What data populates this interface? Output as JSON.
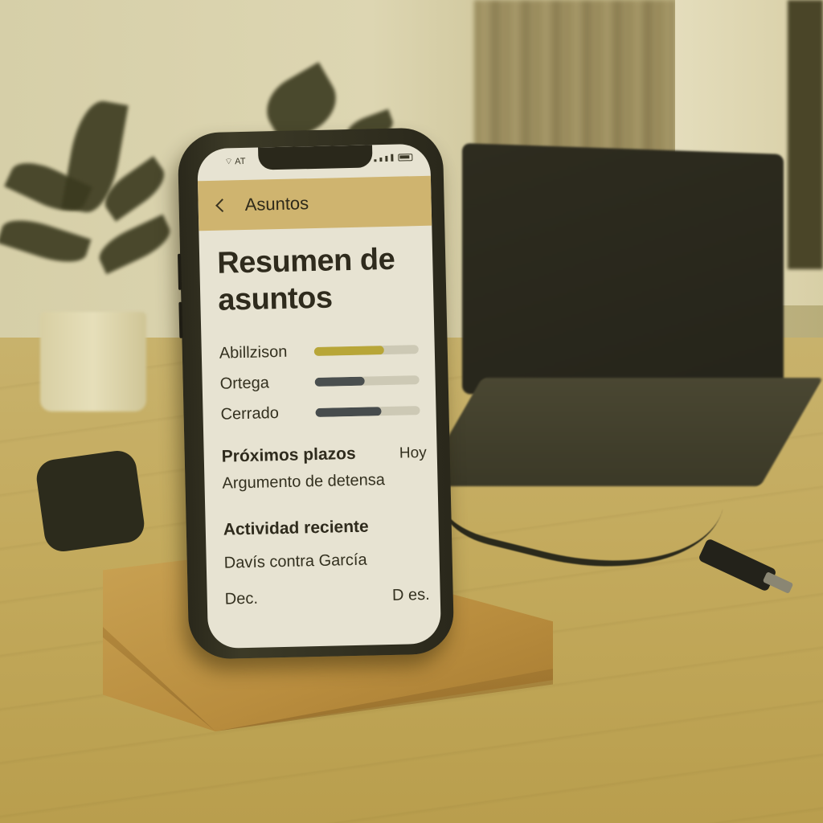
{
  "status_bar": {
    "carrier": "AT"
  },
  "nav": {
    "title": "Asuntos"
  },
  "page": {
    "title_line1": "Resumen de",
    "title_line2": "asuntos"
  },
  "status_rows": [
    {
      "label": "Abillzison",
      "level": 0.67,
      "color": "#b8a638"
    },
    {
      "label": "Ortega",
      "level": 0.48,
      "color": "#4a4f4f"
    },
    {
      "label": "Cerrado",
      "level": 0.63,
      "color": "#474c4d"
    }
  ],
  "deadlines": {
    "title": "Próximos plazos",
    "when": "Hoy",
    "item": "Argumento de detensa"
  },
  "recent": {
    "title": "Actividad reciente",
    "item": "Davís contra García",
    "left": "Dec.",
    "right": "D es."
  }
}
